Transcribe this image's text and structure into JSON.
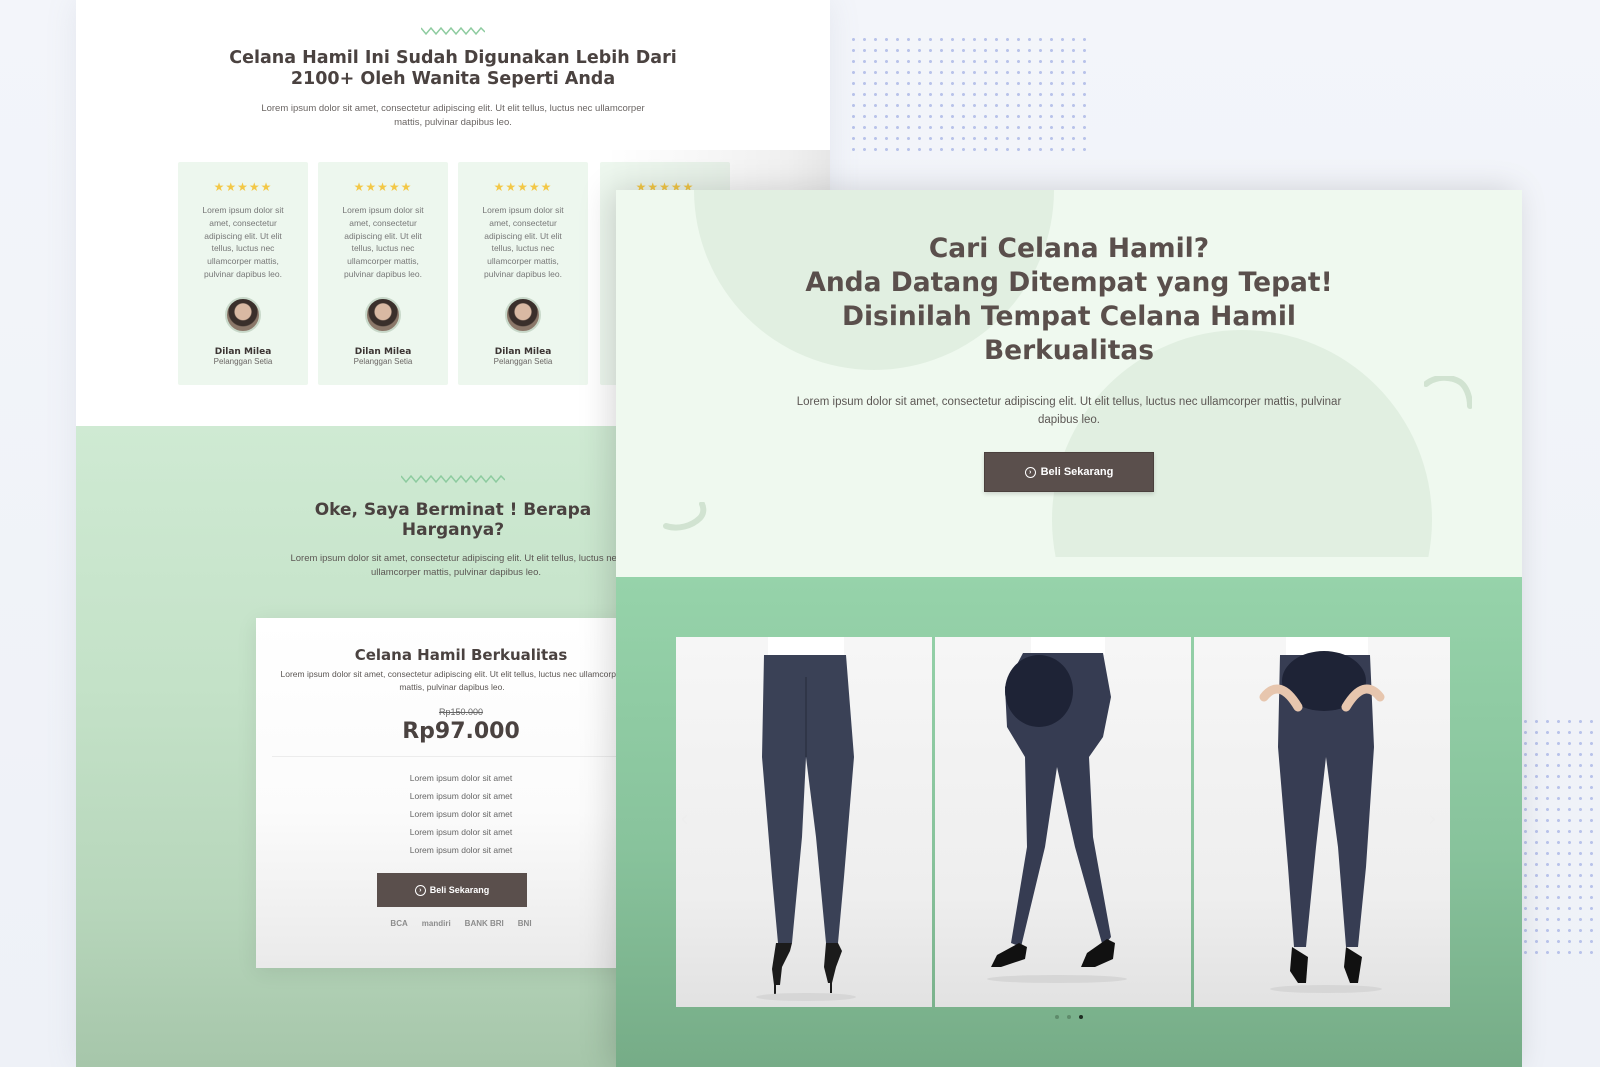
{
  "left_mockup": {
    "testimonials_section": {
      "title": "Celana Hamil Ini Sudah Digunakan Lebih Dari 2100+ Oleh Wanita Seperti Anda",
      "description": "Lorem ipsum dolor sit amet, consectetur adipiscing elit. Ut elit tellus, luctus nec ullamcorper mattis, pulvinar dapibus leo.",
      "cards": [
        {
          "stars": "★★★★★",
          "text": "Lorem ipsum dolor sit amet, consectetur adipiscing elit. Ut elit tellus, luctus nec ullamcorper mattis, pulvinar dapibus leo.",
          "name": "Dilan Milea",
          "role": "Pelanggan Setia"
        },
        {
          "stars": "★★★★★",
          "text": "Lorem ipsum dolor sit amet, consectetur adipiscing elit. Ut elit tellus, luctus nec ullamcorper mattis, pulvinar dapibus leo.",
          "name": "Dilan Milea",
          "role": "Pelanggan Setia"
        },
        {
          "stars": "★★★★★",
          "text": "Lorem ipsum dolor sit amet, consectetur adipiscing elit. Ut elit tellus, luctus nec ullamcorper mattis, pulvinar dapibus leo.",
          "name": "Dilan Milea",
          "role": "Pelanggan Setia"
        },
        {
          "stars": "★★★★★",
          "text": "",
          "name": "",
          "role": ""
        }
      ]
    },
    "pricing_section": {
      "title": "Oke, Saya Berminat ! Berapa Harganya?",
      "description": "Lorem ipsum dolor sit amet, consectetur adipiscing elit. Ut elit tellus, luctus nec ullamcorper mattis, pulvinar dapibus leo.",
      "card": {
        "title": "Celana Hamil Berkualitas",
        "description": "Lorem ipsum dolor sit amet, consectetur adipiscing elit. Ut elit tellus, luctus nec ullamcorper mattis, pulvinar dapibus leo.",
        "old_price": "Rp150.000",
        "price": "Rp97.000",
        "features": [
          "Lorem ipsum dolor sit amet",
          "Lorem ipsum dolor sit amet",
          "Lorem ipsum dolor sit amet",
          "Lorem ipsum dolor sit amet",
          "Lorem ipsum dolor sit amet"
        ],
        "button_label": "Beli Sekarang",
        "banks": [
          "BCA",
          "mandiri",
          "BANK BRI",
          "BNI"
        ]
      }
    }
  },
  "front_mockup": {
    "hero": {
      "title_lines": [
        "Cari Celana Hamil?",
        "Anda Datang Ditempat yang Tepat!",
        "Disinilah Tempat Celana Hamil",
        "Berkualitas"
      ],
      "description": "Lorem ipsum dolor sit amet, consectetur adipiscing elit. Ut elit tellus, luctus nec ullamcorper mattis, pulvinar dapibus leo.",
      "button_label": "Beli Sekarang"
    },
    "gallery": {
      "images": [
        "maternity-leggings-back-view",
        "maternity-leggings-side-view",
        "maternity-leggings-front-view"
      ],
      "prev_icon": "chevron-left-icon",
      "next_icon": "chevron-right-icon",
      "active_dot": 3,
      "dot_count": 3
    }
  },
  "colors": {
    "accent_brown": "#5a4f4c",
    "mint_light": "#eff9ef",
    "green_gallery": "#96d3aa",
    "star_yellow": "#f3c847"
  }
}
